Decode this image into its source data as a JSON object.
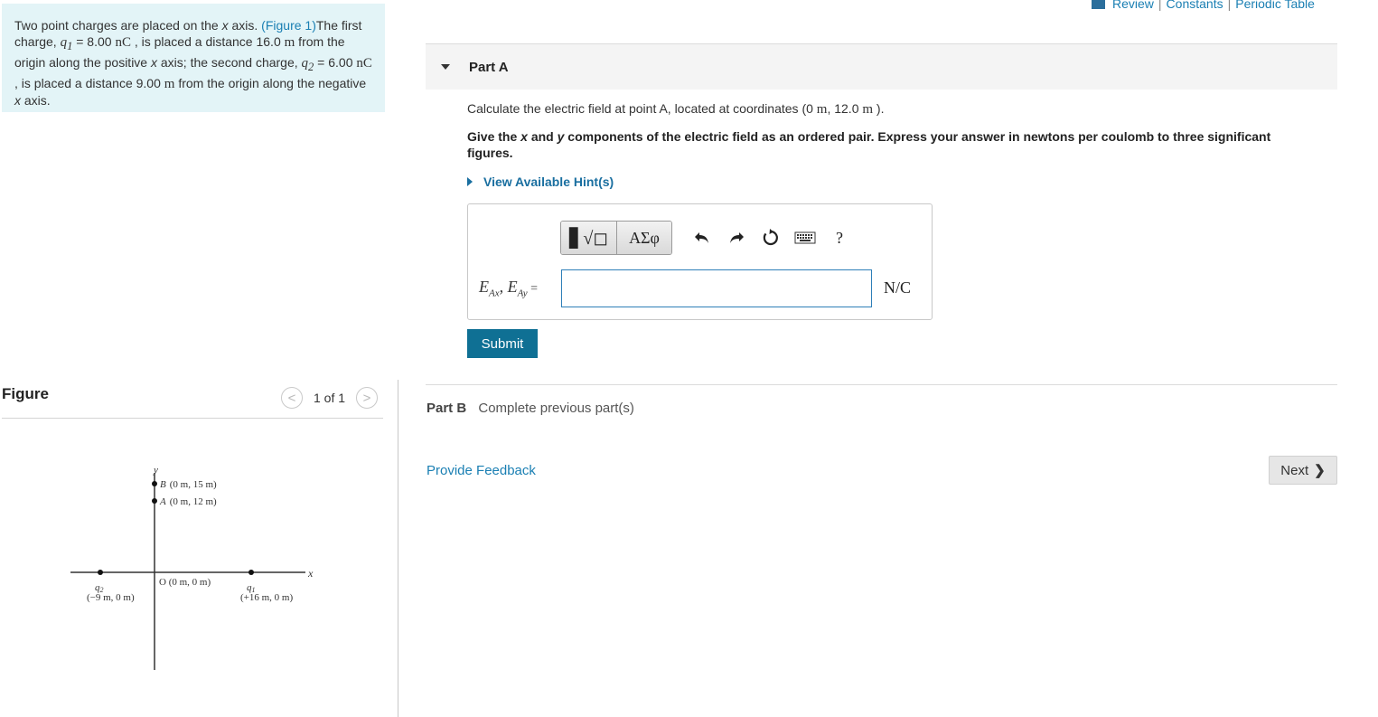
{
  "problem": {
    "t1": "Two point charges are placed on the ",
    "x1": "x",
    "t2": " axis. ",
    "fig_link": "(Figure 1)",
    "t3": "The first charge, ",
    "q1_sym": "q",
    "q1_sub": "1",
    "t4": " = 8.00 ",
    "unit_nC1": "nC",
    "t5": " , is placed a distance 16.0 ",
    "unit_m1": "m",
    "t6": " from the origin along the positive ",
    "x2": "x",
    "t7": " axis; the second charge, ",
    "q2_sym": "q",
    "q2_sub": "2",
    "t8": " = 6.00 ",
    "unit_nC2": "nC",
    "t9": " , is placed a distance 9.00 ",
    "unit_m2": "m",
    "t10": " from the origin along the negative ",
    "x3": "x",
    "t11": " axis."
  },
  "figure": {
    "label": "Figure",
    "prev": "<",
    "count": "1 of 1",
    "next": ">",
    "diagram": {
      "y_axis": "y",
      "x_axis": "x",
      "B_letter": "B",
      "B_coords": "(0 m, 15 m)",
      "A_letter": "A",
      "A_coords": "(0 m, 12 m)",
      "O_label": "O (0 m, 0 m)",
      "q2_sym": "q",
      "q2_sub": "2",
      "q2_coords": "(−9 m, 0 m)",
      "q1_sym": "q",
      "q1_sub": "1",
      "q1_coords": "(+16 m, 0 m)"
    }
  },
  "header_links": {
    "review": "Review",
    "constants": "Constants",
    "periodic": "Periodic Table",
    "sep": "|"
  },
  "partA": {
    "title": "Part A",
    "question_prefix": "Calculate the electric field at point A, located at coordinates (0 ",
    "q_m1": "m",
    "question_mid": ", 12.0 ",
    "q_m2": "m",
    "question_suffix": " ).",
    "instr1": "Give the ",
    "instr_x": "x",
    "instr2": " and ",
    "instr_y": "y",
    "instr3": " components of the electric field as an ordered pair. Express your answer in newtons per coulomb to three significant figures.",
    "hint": "View Available Hint(s)",
    "toolbar": {
      "templates_glyph": "▋√◻",
      "symbols": "ΑΣφ",
      "undo": "↶",
      "redo": "↷",
      "reset": "↻",
      "help": "?"
    },
    "eq": {
      "E": "E",
      "sub_ax": "Ax",
      "comma": ", ",
      "sub_ay": "Ay",
      "equals": " ="
    },
    "input_value": "",
    "unit": "N/C",
    "submit": "Submit"
  },
  "partB": {
    "label": "Part B",
    "status": "Complete previous part(s)"
  },
  "footer": {
    "feedback": "Provide Feedback",
    "next": "Next",
    "next_chevron": "❯"
  }
}
